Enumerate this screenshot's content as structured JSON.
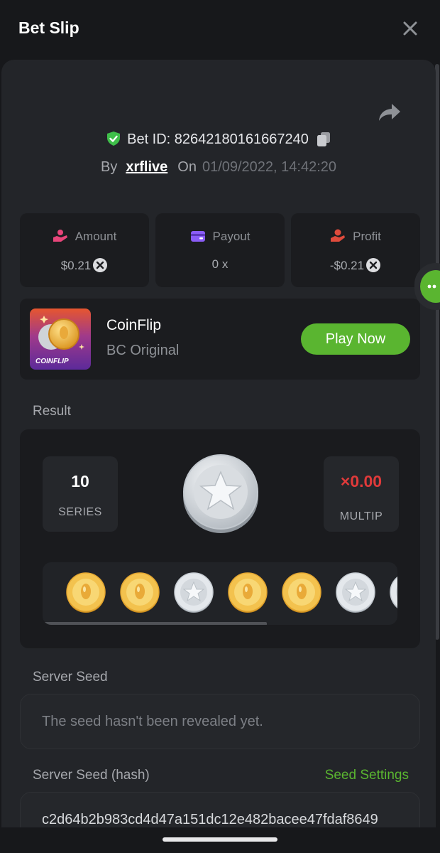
{
  "header": {
    "title": "Bet Slip"
  },
  "bet": {
    "id_label": "Bet ID: 82642180161667240",
    "by_label": "By",
    "user": "xrflive",
    "on_label": "On",
    "date": "01/09/2022, 14:42:20"
  },
  "stats": [
    {
      "label": "Amount",
      "value": "$0.21",
      "icon": "hand-coin-icon",
      "color": "#e7457a"
    },
    {
      "label": "Payout",
      "value": "0 x",
      "icon": "wallet-icon",
      "color": "#8a5cf6"
    },
    {
      "label": "Profit",
      "value": "-$0.21",
      "icon": "hand-money-icon",
      "color": "#e04b3c"
    }
  ],
  "game": {
    "name": "CoinFlip",
    "provider": "BC Original",
    "thumb_label": "COINFLIP",
    "play_label": "Play Now"
  },
  "result": {
    "section_label": "Result",
    "series_value": "10",
    "series_label": "SERIES",
    "multiplier_value": "×0.00",
    "multiplier_label": "MULTIP",
    "multiplier_color": "#e03a3a",
    "coin_sequence": [
      "gold",
      "gold",
      "silver",
      "gold",
      "gold",
      "silver",
      "silver"
    ]
  },
  "server_seed": {
    "label": "Server Seed",
    "value": "The seed hasn't been revealed yet."
  },
  "server_seed_hash": {
    "label": "Server Seed (hash)",
    "settings_label": "Seed Settings",
    "value": "c2d64b2b983cd4d47a151dc12e482bacee47fdaf8649"
  },
  "colors": {
    "accent": "#5ab530",
    "background": "#17181b",
    "panel": "#232529"
  }
}
